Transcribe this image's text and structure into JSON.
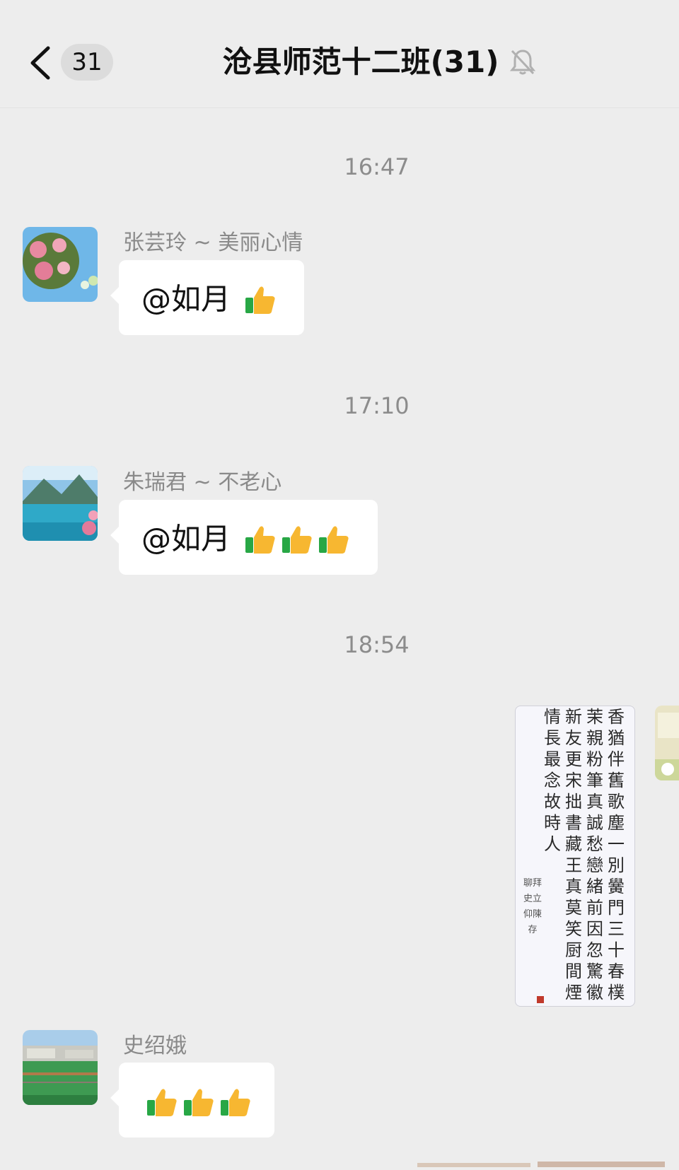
{
  "header": {
    "unread_count": "31",
    "title": "沧县师范十二班(31)"
  },
  "messages": [
    {
      "time": "16:47",
      "sender": "张芸玲 ~ 美丽心情",
      "text": "@如月",
      "thumbs": 1
    },
    {
      "time": "17:10",
      "sender": "朱瑞君 ~ 不老心",
      "text": "@如月",
      "thumbs": 3
    },
    {
      "time": "18:54",
      "type": "image",
      "from_self": true,
      "image_text": [
        "香猶伴舊歌塵一別黌門三十春樸",
        "茉親粉筆真誠愁戀緒前因忽驚徽",
        "新友更宋拙書藏王真莫笑厨間煙",
        "情長最念故時人"
      ],
      "signature": "聊拜史立仰陳存"
    },
    {
      "sender": "史绍娥",
      "text": "",
      "thumbs": 3
    }
  ],
  "icons": {
    "back": "chevron-left-icon",
    "mute": "bell-off-icon",
    "thumb": "thumbs-up-icon"
  },
  "colors": {
    "background": "#ededed",
    "bubble": "#ffffff",
    "thumb": "#f7b731",
    "cuff": "#28a745"
  }
}
